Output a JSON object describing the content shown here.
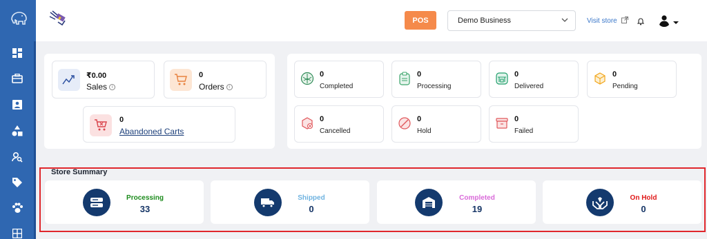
{
  "header": {
    "pos_label": "POS",
    "business_select": "Demo Business",
    "visit_store": "Visit store"
  },
  "sidebar": {
    "icons": [
      "elephant-logo-icon",
      "dashboard-icon",
      "briefcase-icon",
      "contact-card-icon",
      "shapes-icon",
      "search-user-icon",
      "tag-icon",
      "paw-icon",
      "grid-icon"
    ]
  },
  "overview": {
    "sales_value": "₹0.00",
    "sales_label": "Sales",
    "orders_value": "0",
    "orders_label": "Orders",
    "abandoned_value": "0",
    "abandoned_label": "Abandoned Carts"
  },
  "statuses": [
    {
      "value": "0",
      "label": "Completed",
      "color": "#2e8b57"
    },
    {
      "value": "0",
      "label": "Processing",
      "color": "#3aa46a"
    },
    {
      "value": "0",
      "label": "Delivered",
      "color": "#1f9e6a"
    },
    {
      "value": "0",
      "label": "Pending",
      "color": "#f2a61c"
    },
    {
      "value": "0",
      "label": "Cancelled",
      "color": "#e0575b"
    },
    {
      "value": "0",
      "label": "Hold",
      "color": "#e0575b"
    },
    {
      "value": "0",
      "label": "Failed",
      "color": "#e0575b"
    }
  ],
  "summary": {
    "title": "Store Summary",
    "items": [
      {
        "label": "Processing",
        "value": "33",
        "color": "#1a8a1a"
      },
      {
        "label": "Shipped",
        "value": "0",
        "color": "#6fb3e0"
      },
      {
        "label": "Completed",
        "value": "19",
        "color": "#d96ad9"
      },
      {
        "label": "On Hold",
        "value": "0",
        "color": "#e01818"
      }
    ]
  }
}
